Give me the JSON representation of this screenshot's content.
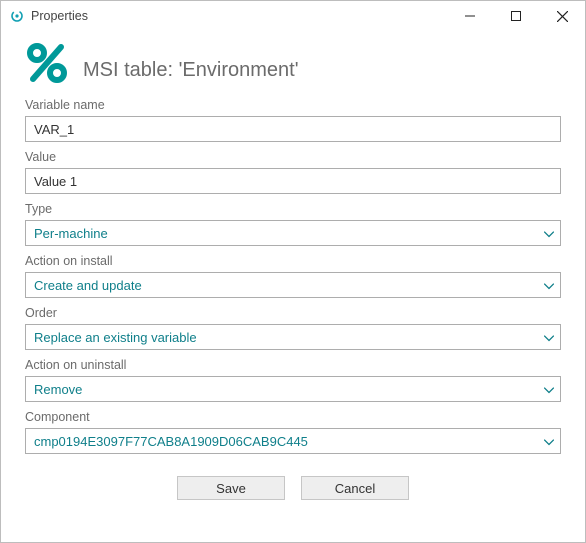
{
  "window": {
    "title": "Properties"
  },
  "header": {
    "title": "MSI table: 'Environment'"
  },
  "fields": {
    "variable_name": {
      "label": "Variable name",
      "value": "VAR_1"
    },
    "value": {
      "label": "Value",
      "value": "Value 1"
    },
    "type": {
      "label": "Type",
      "value": "Per-machine"
    },
    "action_install": {
      "label": "Action on install",
      "value": "Create and update"
    },
    "order": {
      "label": "Order",
      "value": "Replace an existing variable"
    },
    "action_uninstall": {
      "label": "Action on uninstall",
      "value": "Remove"
    },
    "component": {
      "label": "Component",
      "value": "cmp0194E3097F77CAB8A1909D06CAB9C445"
    }
  },
  "buttons": {
    "save": "Save",
    "cancel": "Cancel"
  },
  "colors": {
    "accent": "#009999",
    "select_text": "#0f7f8a"
  }
}
